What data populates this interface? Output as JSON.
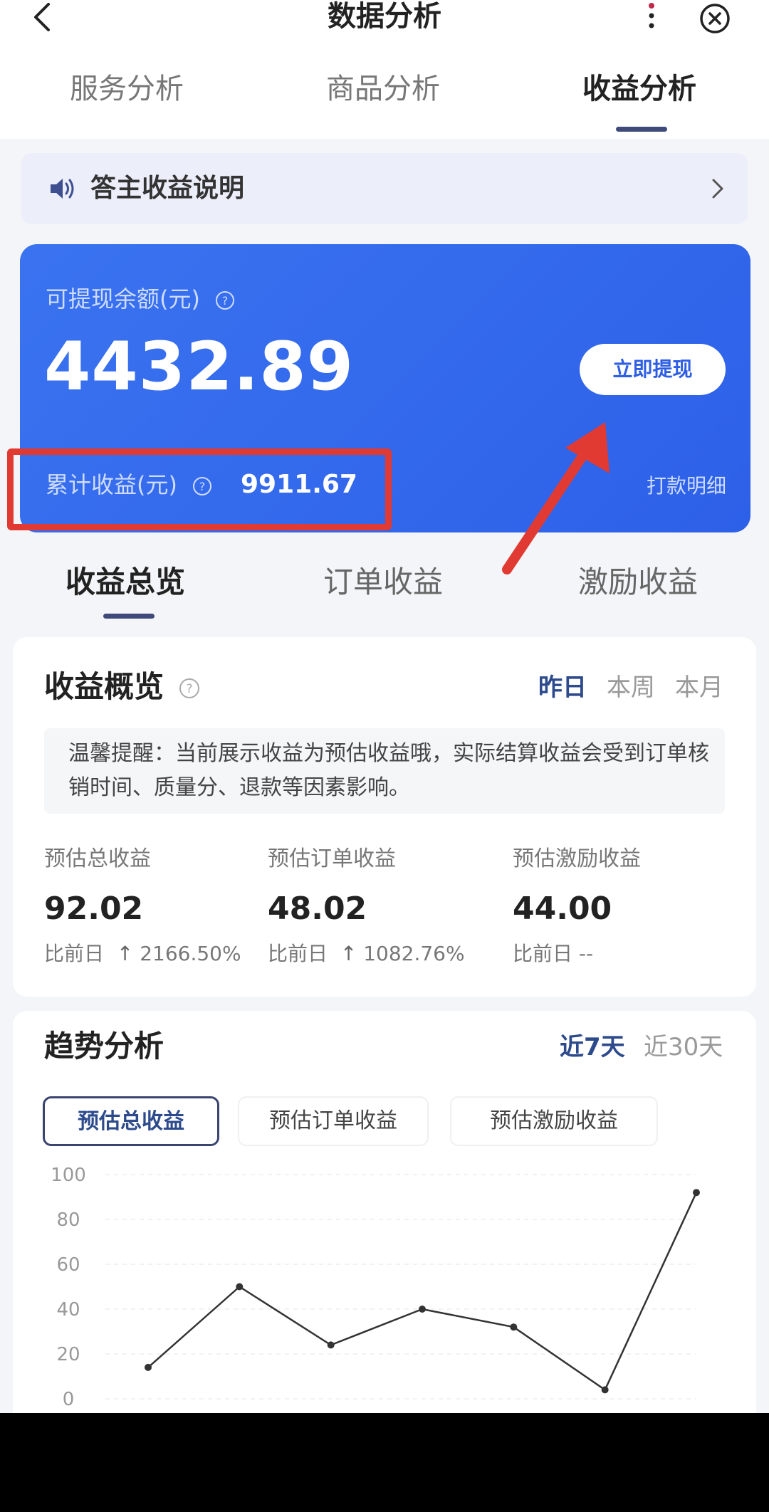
{
  "header": {
    "title": "数据分析"
  },
  "top_tabs": [
    "服务分析",
    "商品分析",
    "收益分析"
  ],
  "notice": {
    "text": "答主收益说明"
  },
  "balance": {
    "label": "可提现余额(元)",
    "amount": "4432.89",
    "withdraw_label": "立即提现",
    "cumulative_label": "累计收益(元)",
    "cumulative_value": "9911.67",
    "detail_link": "打款明细"
  },
  "income_tabs": [
    "收益总览",
    "订单收益",
    "激励收益"
  ],
  "overview": {
    "title": "收益概览",
    "periods": [
      "昨日",
      "本周",
      "本月"
    ],
    "tip": "温馨提醒：当前展示收益为预估收益哦，实际结算收益会受到订单核销时间、质量分、退款等因素影响。",
    "metrics": [
      {
        "label": "预估总收益",
        "value": "92.02",
        "compare_prefix": "比前日",
        "compare_value": "2166.50%",
        "arrow": "up"
      },
      {
        "label": "预估订单收益",
        "value": "48.02",
        "compare_prefix": "比前日",
        "compare_value": "1082.76%",
        "arrow": "up"
      },
      {
        "label": "预估激励收益",
        "value": "44.00",
        "compare_prefix": "比前日",
        "compare_value": "--",
        "arrow": "none"
      }
    ]
  },
  "trend": {
    "title": "趋势分析",
    "ranges": [
      "近7天",
      "近30天"
    ],
    "chips": [
      "预估总收益",
      "预估订单收益",
      "预估激励收益"
    ]
  },
  "colors": {
    "card_blue": "#2d60e8",
    "accent_dark": "#2c4a8c",
    "highlight_red": "#e03a32"
  },
  "chart_data": {
    "type": "line",
    "x": [
      1,
      2,
      3,
      4,
      5,
      6,
      7
    ],
    "series": [
      {
        "values": [
          14,
          50,
          24,
          40,
          32,
          4,
          92
        ]
      }
    ],
    "yticks": [
      0,
      20,
      40,
      60,
      80,
      100
    ],
    "ylim": [
      0,
      100
    ],
    "grid": true
  }
}
